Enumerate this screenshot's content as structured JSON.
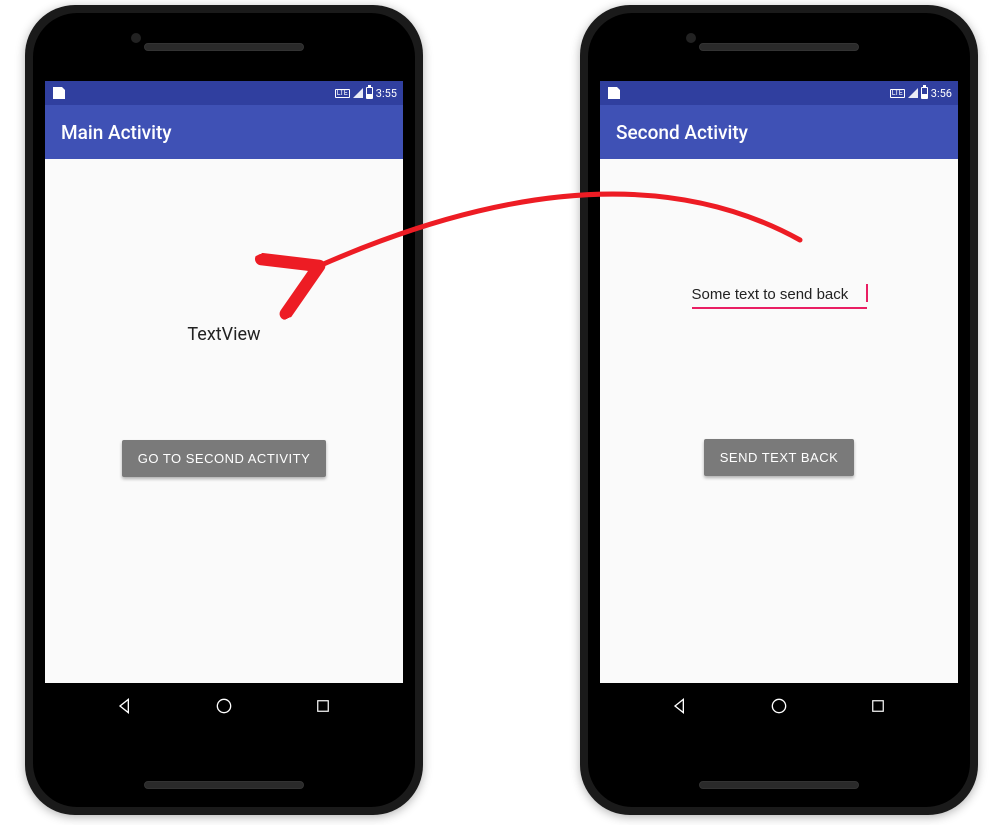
{
  "left": {
    "statusbar": {
      "time": "3:55"
    },
    "actionbar": {
      "title": "Main Activity"
    },
    "content": {
      "textview": "TextView",
      "button_label": "GO TO SECOND ACTIVITY"
    }
  },
  "right": {
    "statusbar": {
      "time": "3:56"
    },
    "actionbar": {
      "title": "Second Activity"
    },
    "content": {
      "edittext_value": "Some text to send back",
      "button_label": "SEND TEXT BACK"
    }
  },
  "colors": {
    "primary": "#3F51B5",
    "primary_dark": "#303F9F",
    "accent": "#E91E63",
    "arrow": "#ED1C24"
  }
}
